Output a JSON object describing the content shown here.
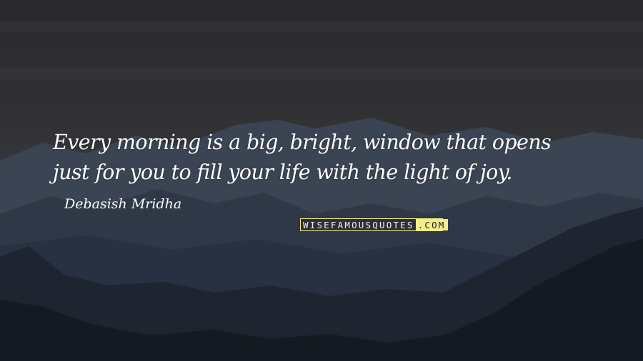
{
  "quote": {
    "line1": "Every morning is a big, bright, window that opens",
    "line2": "just for you to fill your life with the light of joy."
  },
  "author": "Debasish Mridha",
  "watermark": {
    "left": "WISEFAMOUSQUOTES",
    "right": ".COM"
  },
  "colors": {
    "sky_top": "#2a2a2c",
    "sky_mid": "#333439",
    "far_mountains": "#3b4452",
    "mid_mountains": "#2d3644",
    "near_mountains": "#1c232d",
    "foreground": "#14181f",
    "text": "#ffffff",
    "watermark_accent": "#f2ee8a"
  }
}
